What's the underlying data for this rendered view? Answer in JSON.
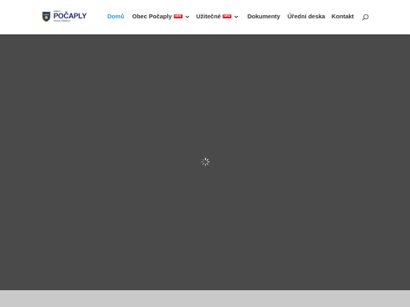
{
  "logo": {
    "small_text": "OBEC",
    "main_text": "POČAPLY",
    "sub_text": "OKRES PŘÍBRAM"
  },
  "nav": {
    "items": [
      {
        "label": "Domů",
        "active": true
      },
      {
        "label": "Obec Počaply",
        "badge": "NEW",
        "has_dropdown": true
      },
      {
        "label": "Užitečné",
        "badge": "NEW",
        "has_dropdown": true
      },
      {
        "label": "Dokumenty"
      },
      {
        "label": "Úřední deska"
      },
      {
        "label": "Kontakt"
      }
    ],
    "search_icon": "search-icon"
  },
  "colors": {
    "accent": "#2b9bd6",
    "badge": "#d8232a",
    "hero_bg": "#4a4a4a",
    "footer_strip": "#c9c9c9"
  },
  "hero": {
    "loading_icon": "spinner-icon"
  }
}
